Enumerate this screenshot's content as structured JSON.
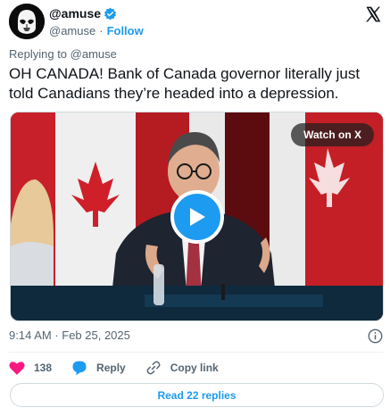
{
  "header": {
    "handle": "@amuse",
    "sub_handle": "@amuse",
    "separator": "·",
    "follow_label": "Follow"
  },
  "tweet": {
    "replying_prefix": "Replying to",
    "replying_to": "@amuse",
    "text": "OH CANADA! Bank of Canada governor literally just told Canadians they’re headed into a depression."
  },
  "media": {
    "watch_label": "Watch on X"
  },
  "meta": {
    "timestamp": "9:14 AM · Feb 25, 2025"
  },
  "actions": {
    "like_count": "138",
    "reply_label": "Reply",
    "copy_link_label": "Copy link"
  },
  "footer": {
    "read_replies_label": "Read 22 replies"
  },
  "colors": {
    "accent": "#1d9bf0",
    "like": "#f91880",
    "muted_text": "#536471",
    "canada_red": "#d52b1e"
  },
  "icons": {
    "avatar": "avatar-stormtrooper",
    "verified": "verified-badge-icon",
    "brand": "x-logo-icon",
    "play": "play-icon",
    "info": "info-icon",
    "like": "heart-icon",
    "reply": "reply-bubble-icon",
    "link": "link-icon"
  }
}
